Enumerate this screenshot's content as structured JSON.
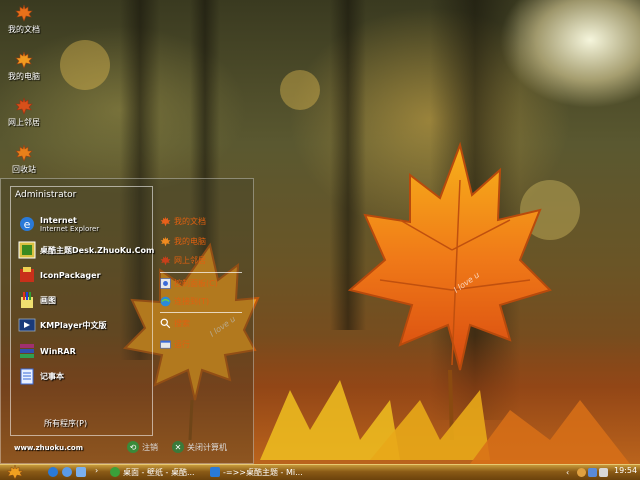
{
  "desktop_icons": [
    {
      "label": "我的文档",
      "icon": "maple-leaf-icon"
    },
    {
      "label": "我的电脑",
      "icon": "maple-leaf-icon"
    },
    {
      "label": "网上邻居",
      "icon": "maple-leaf-icon"
    },
    {
      "label": "回收站",
      "icon": "maple-leaf-icon"
    }
  ],
  "start_menu": {
    "user": "Administrator",
    "programs": [
      {
        "name": "Internet",
        "sub": "Internet Explorer",
        "icon": "internet-explorer-icon"
      },
      {
        "name": "桌酷主题Desk.ZhuoKu.Com",
        "sub": "",
        "icon": "zhuoku-theme-icon"
      },
      {
        "name": "IconPackager",
        "sub": "",
        "icon": "iconpackager-icon"
      },
      {
        "name": "画图",
        "sub": "",
        "icon": "paint-icon"
      },
      {
        "name": "KMPlayer中文版",
        "sub": "",
        "icon": "kmplayer-icon"
      },
      {
        "name": "WinRAR",
        "sub": "",
        "icon": "winrar-icon"
      },
      {
        "name": "记事本",
        "sub": "",
        "icon": "notepad-icon"
      }
    ],
    "right_items": [
      {
        "label": "我的文档",
        "icon": "maple-leaf-icon"
      },
      {
        "label": "我的电脑",
        "icon": "maple-leaf-icon"
      },
      {
        "label": "网上邻居",
        "icon": "maple-leaf-icon"
      },
      {
        "label": "控制面板(C)",
        "icon": "control-panel-icon"
      },
      {
        "label": "连接到(T)",
        "icon": "connect-to-icon"
      },
      {
        "label": "搜索",
        "icon": "search-icon"
      },
      {
        "label": "运行",
        "icon": "run-icon"
      }
    ],
    "all_programs": "所有程序(P)",
    "url": "www.zhuoku.com",
    "logoff": "注销",
    "shutdown": "关闭计算机"
  },
  "taskbar": {
    "tasks": [
      {
        "label": "桌面 - 壁纸 - 桌酷...",
        "icon": "green-app-icon"
      },
      {
        "label": "-=>>桌酷主题 - Mi...",
        "icon": "ie-window-icon"
      }
    ],
    "clock": "19:54"
  },
  "leaf_text": "I love u",
  "colors": {
    "accent": "#e06010",
    "taskbar": "#8a5a16"
  }
}
